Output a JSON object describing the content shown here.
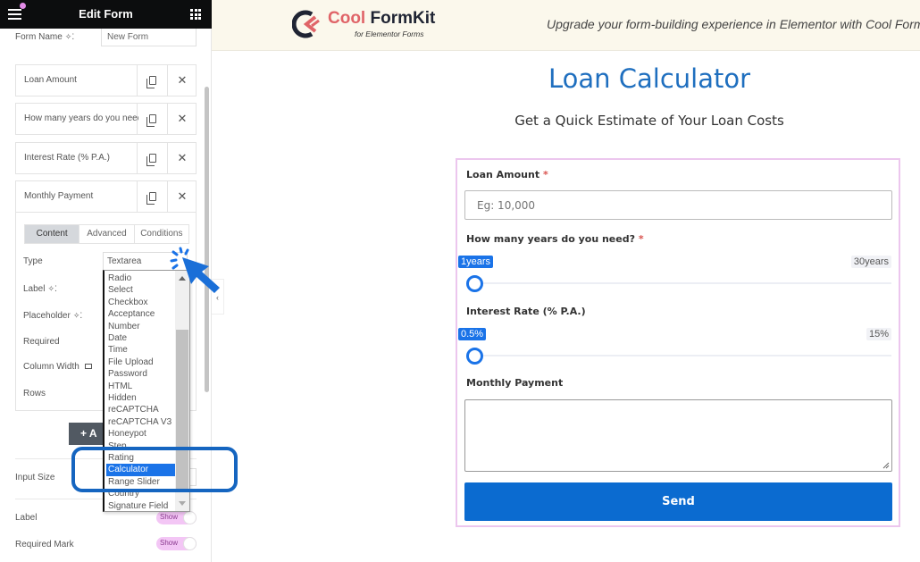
{
  "editor": {
    "title": "Edit Form",
    "form_name_label": "Form Name",
    "form_name_value": "New Form",
    "fields": [
      {
        "label": "Loan Amount"
      },
      {
        "label": "How many years do you need?"
      },
      {
        "label": "Interest Rate (% P.A.)"
      },
      {
        "label": "Monthly Payment"
      }
    ],
    "tabs": [
      "Content",
      "Advanced",
      "Conditions"
    ],
    "controls": {
      "type_label": "Type",
      "type_value": "Textarea",
      "label_label": "Label",
      "placeholder_label": "Placeholder",
      "required_label": "Required",
      "column_width_label": "Column Width",
      "rows_label": "Rows"
    },
    "add_item_label": "+ A",
    "input_size_label": "Input Size",
    "label_toggle": {
      "label": "Label",
      "value": "Show"
    },
    "required_mark_toggle": {
      "label": "Required Mark",
      "value": "Show"
    },
    "collapse_glyph": "‹",
    "type_options": [
      "Radio",
      "Select",
      "Checkbox",
      "Acceptance",
      "Number",
      "Date",
      "Time",
      "File Upload",
      "Password",
      "HTML",
      "Hidden",
      "reCAPTCHA",
      "reCAPTCHA V3",
      "Honeypot",
      "Step",
      "Rating",
      "Calculator",
      "Range Slider",
      "Country",
      "Signature Field"
    ],
    "selected_option": "Calculator"
  },
  "banner": {
    "brand_cool": "Cool",
    "brand_formkit": " FormKit",
    "brand_sub": "for Elementor Forms",
    "tagline": "Upgrade your form-building experience in Elementor with Cool FormKit"
  },
  "preview": {
    "title": "Loan Calculator",
    "subtitle": "Get a Quick Estimate of Your Loan Costs",
    "loan_amount": {
      "label": "Loan Amount",
      "required_mark": "*",
      "placeholder": "Eg: 10,000"
    },
    "years": {
      "label": "How many years do you need?",
      "required_mark": "*",
      "min_label": "1years",
      "max_label": "30years",
      "value_fraction": 0
    },
    "interest": {
      "label": "Interest Rate (% P.A.)",
      "min_label": "0.5%",
      "max_label": "15%",
      "value_fraction": 0
    },
    "monthly_payment": {
      "label": "Monthly Payment",
      "value": ""
    },
    "send_label": "Send"
  },
  "colors": {
    "accent_blue": "#1a73e8",
    "button_blue": "#0b6bd0",
    "title_blue": "#1f6fbf",
    "form_border": "#ecc6ee",
    "brand_red": "#e06468"
  }
}
